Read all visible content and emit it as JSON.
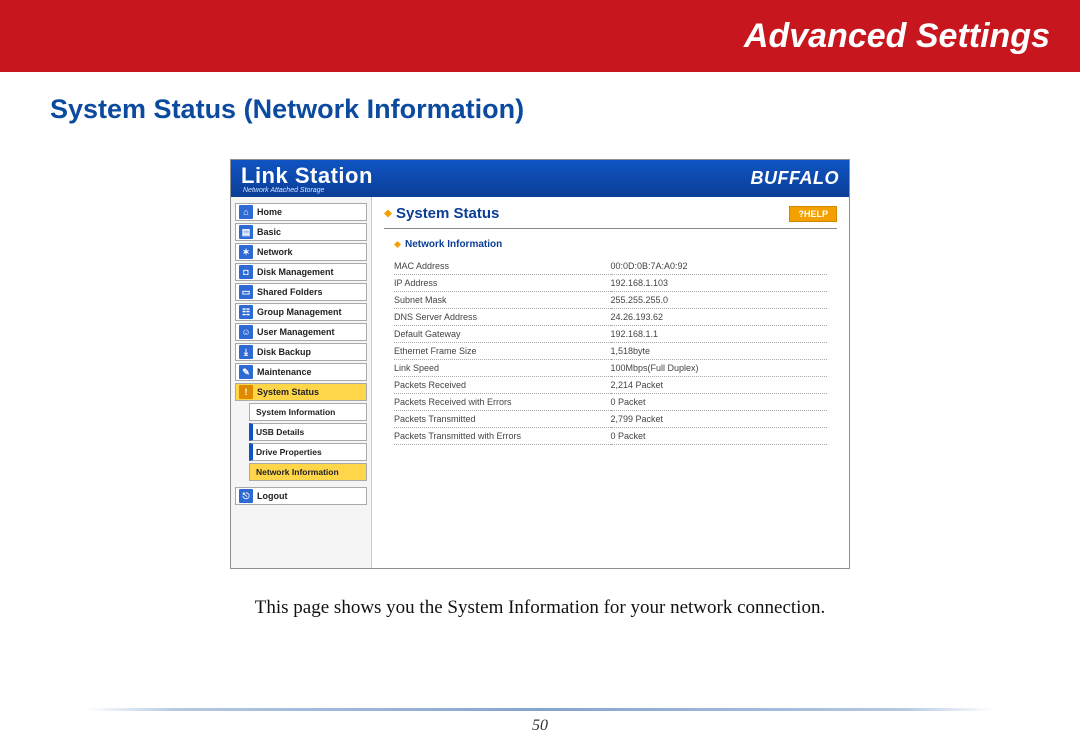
{
  "banner": {
    "title": "Advanced Settings"
  },
  "section": {
    "title": "System Status (Network Information)"
  },
  "app": {
    "brand_left": "Link Station",
    "brand_left_sub": "Network Attached Storage",
    "brand_right": "BUFFALO",
    "help_label": "?HELP",
    "content_title": "System Status",
    "sub_heading": "Network Information"
  },
  "sidebar": {
    "items": [
      {
        "label": "Home"
      },
      {
        "label": "Basic"
      },
      {
        "label": "Network"
      },
      {
        "label": "Disk Management"
      },
      {
        "label": "Shared Folders"
      },
      {
        "label": "Group Management"
      },
      {
        "label": "User Management"
      },
      {
        "label": "Disk Backup"
      },
      {
        "label": "Maintenance"
      },
      {
        "label": "System Status"
      }
    ],
    "subs": [
      {
        "label": "System Information"
      },
      {
        "label": "USB Details"
      },
      {
        "label": "Drive Properties"
      },
      {
        "label": "Network Information"
      }
    ],
    "logout": "Logout"
  },
  "network_info": [
    {
      "label": "MAC Address",
      "value": "00:0D:0B:7A:A0:92"
    },
    {
      "label": "IP Address",
      "value": "192.168.1.103"
    },
    {
      "label": "Subnet Mask",
      "value": "255.255.255.0"
    },
    {
      "label": "DNS Server Address",
      "value": "24.26.193.62"
    },
    {
      "label": "Default Gateway",
      "value": "192.168.1.1"
    },
    {
      "label": "Ethernet Frame Size",
      "value": "1,518byte"
    },
    {
      "label": "Link Speed",
      "value": "100Mbps(Full Duplex)"
    },
    {
      "label": "Packets Received",
      "value": "2,214 Packet"
    },
    {
      "label": "Packets Received with Errors",
      "value": "0 Packet"
    },
    {
      "label": "Packets Transmitted",
      "value": "2,799 Packet"
    },
    {
      "label": "Packets Transmitted with Errors",
      "value": "0 Packet"
    }
  ],
  "caption": "This page shows you the System Information for your network connection.",
  "page_number": "50"
}
